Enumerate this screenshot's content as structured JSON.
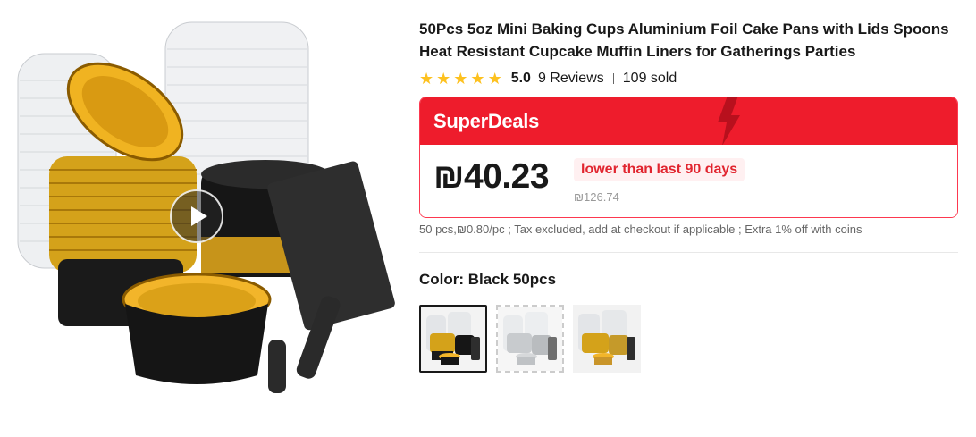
{
  "product": {
    "title": "50Pcs 5oz Mini Baking Cups Aluminium Foil Cake Pans with Lids Spoons Heat Resistant Cupcake Muffin Liners for Gatherings Parties",
    "rating": "5.0",
    "stars": 5,
    "reviews": "9 Reviews",
    "sold": "109 sold"
  },
  "deal": {
    "title": "SuperDeals",
    "price": "₪40.23",
    "lower_badge": "lower than last 90 days",
    "original_price": "₪126.74",
    "unit_info": "50 pcs,₪0.80/pc ; Tax excluded, add at checkout if applicable ; Extra 1% off with coins"
  },
  "color": {
    "label": "Color: Black 50pcs",
    "options": [
      "Black 50pcs",
      "Silver 50pcs",
      "Gold 50pcs"
    ],
    "selected_index": 0
  },
  "icons": {
    "play": "play-icon",
    "star": "star-icon",
    "bolt": "lightning-icon"
  },
  "colors": {
    "accent_red": "#ee1c2c",
    "star_yellow": "#fdc11f",
    "badge_text": "#e1252f"
  }
}
